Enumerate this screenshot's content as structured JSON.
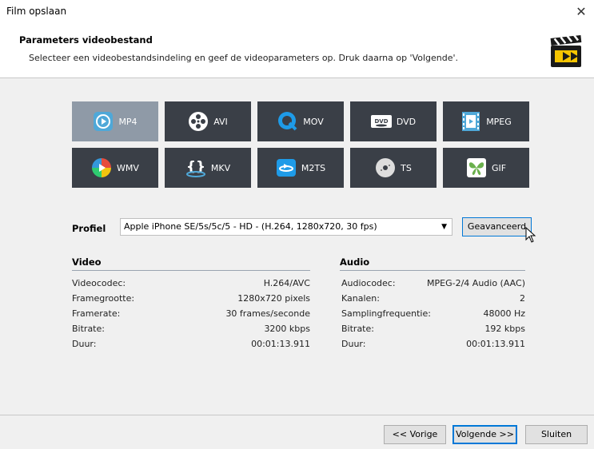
{
  "window": {
    "title": "Film opslaan",
    "close_glyph": "✕"
  },
  "header": {
    "title": "Parameters videobestand",
    "subtitle": "Selecteer een videobestandsindeling en geef de videoparameters op. Druk daarna op 'Volgende'.",
    "icon": "clapperboard-icon"
  },
  "formats": [
    {
      "label": "MP4",
      "icon": "mp4-icon",
      "selected": true
    },
    {
      "label": "AVI",
      "icon": "film-reel-icon",
      "selected": false
    },
    {
      "label": "MOV",
      "icon": "quicktime-icon",
      "selected": false
    },
    {
      "label": "DVD",
      "icon": "dvd-icon",
      "selected": false
    },
    {
      "label": "MPEG",
      "icon": "filmstrip-icon",
      "selected": false
    },
    {
      "label": "WMV",
      "icon": "windows-media-icon",
      "selected": false
    },
    {
      "label": "MKV",
      "icon": "mkv-icon",
      "selected": false
    },
    {
      "label": "M2TS",
      "icon": "bluray-icon",
      "selected": false
    },
    {
      "label": "TS",
      "icon": "disc-icon",
      "selected": false
    },
    {
      "label": "GIF",
      "icon": "butterfly-icon",
      "selected": false
    }
  ],
  "profile": {
    "label": "Profiel",
    "value": "Apple iPhone SE/5s/5c/5 - HD - (H.264, 1280x720, 30 fps)",
    "advanced_label": "Geavanceerd"
  },
  "video": {
    "heading": "Video",
    "rows": [
      {
        "label": "Videocodec:",
        "value": "H.264/AVC"
      },
      {
        "label": "Framegrootte:",
        "value": "1280x720 pixels"
      },
      {
        "label": "Framerate:",
        "value": "30 frames/seconde"
      },
      {
        "label": "Bitrate:",
        "value": "3200 kbps"
      },
      {
        "label": "Duur:",
        "value": "00:01:13.911"
      }
    ]
  },
  "audio": {
    "heading": "Audio",
    "rows": [
      {
        "label": "Audiocodec:",
        "value": "MPEG-2/4 Audio (AAC)"
      },
      {
        "label": "Kanalen:",
        "value": "2"
      },
      {
        "label": "Samplingfrequentie:",
        "value": "48000 Hz"
      },
      {
        "label": "Bitrate:",
        "value": "192 kbps"
      },
      {
        "label": "Duur:",
        "value": "00:01:13.911"
      }
    ]
  },
  "footer": {
    "prev_label": "<< Vorige",
    "next_label": "Volgende >>",
    "close_label": "Sluiten"
  }
}
